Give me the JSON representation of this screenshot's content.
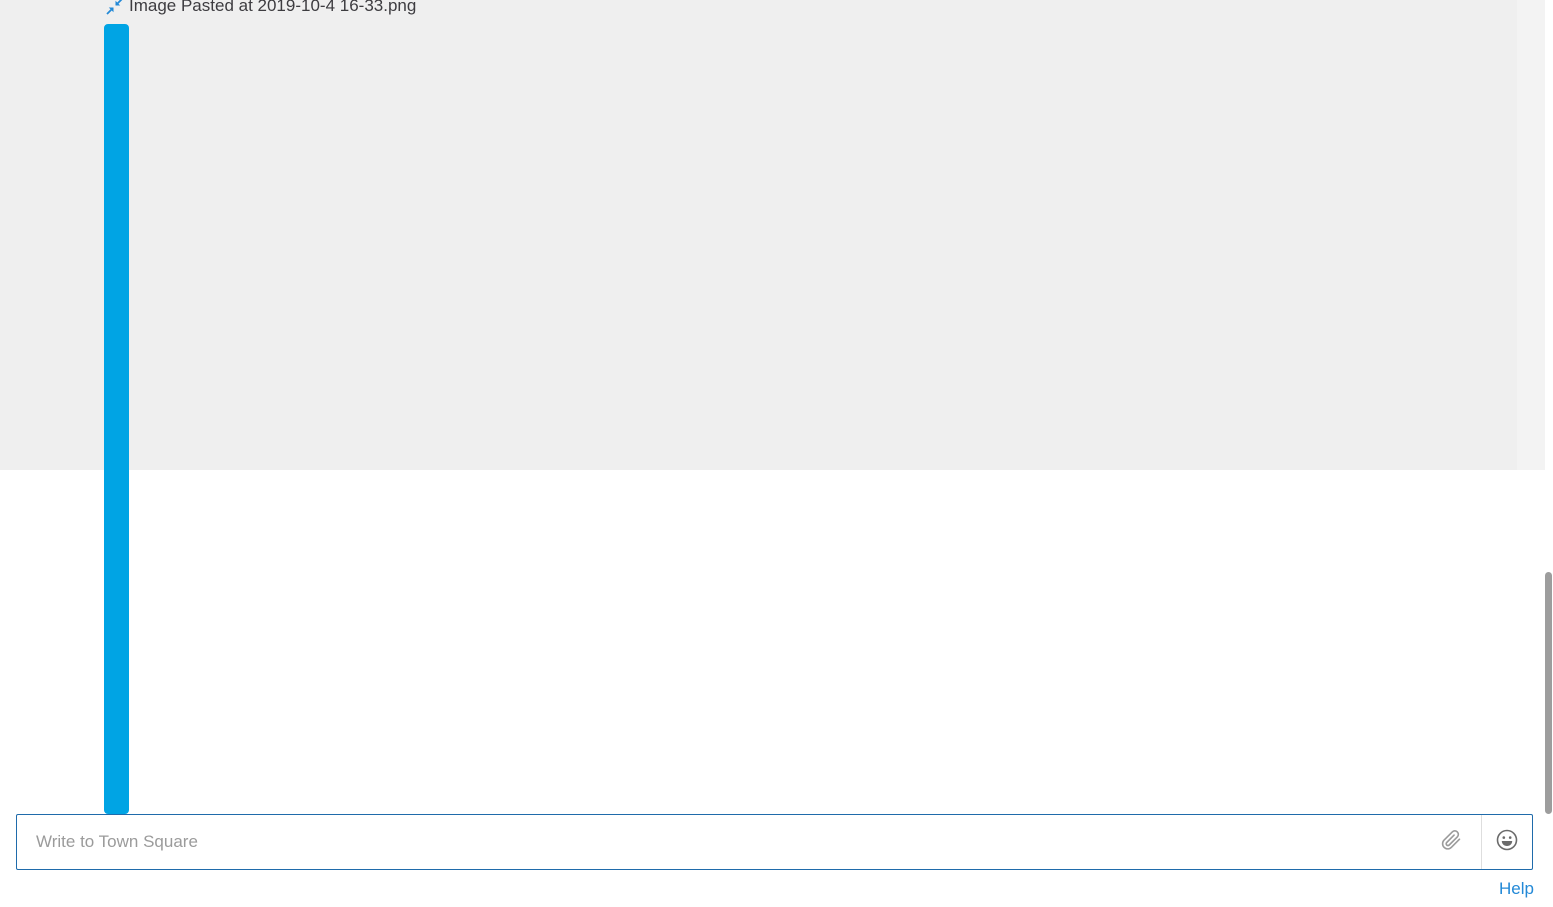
{
  "post": {
    "attachment_name": "Image Pasted at 2019-10-4 16-33.png",
    "collapse_icon": "collapse-arrows-icon",
    "preview_color": "#00a4e4"
  },
  "composer": {
    "placeholder": "Write to Town Square",
    "value": "",
    "attach_icon": "paperclip-icon",
    "emoji_icon": "smiley-icon",
    "border_color": "#1f6bab"
  },
  "footer": {
    "help_label": "Help"
  },
  "colors": {
    "accent": "#2389d7",
    "post_background": "#efefef",
    "text": "#3d3c40"
  }
}
